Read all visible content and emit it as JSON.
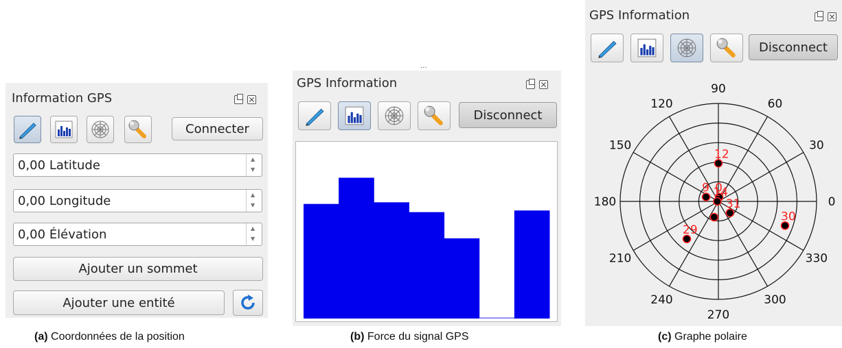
{
  "panel_a": {
    "title": "Information GPS",
    "connect_label": "Connecter",
    "fields": [
      {
        "value": "0,00",
        "name": "Latitude"
      },
      {
        "value": "0,00",
        "name": "Longitude"
      },
      {
        "value": "0,00",
        "name": "Élévation"
      }
    ],
    "add_vertex_label": "Ajouter un sommet",
    "add_feature_label": "Ajouter une entité"
  },
  "panel_b": {
    "title": "GPS Information",
    "disconnect_label": "Disconnect",
    "dots": "..."
  },
  "panel_c": {
    "title": "GPS Information",
    "disconnect_label": "Disconnect"
  },
  "captions": [
    {
      "tag": "(a)",
      "text": "Coordonnées de la position"
    },
    {
      "tag": "(b)",
      "text": "Force du signal GPS"
    },
    {
      "tag": "(c)",
      "text": "Graphe polaire"
    }
  ],
  "colors": {
    "bar": "#0000ee",
    "satellite_label": "#ff2020",
    "panel_bg": "#efefef"
  },
  "chart_data": [
    {
      "type": "bar",
      "description_of_axes": "none printed",
      "values": [
        0.7,
        0.86,
        0.71,
        0.65,
        0.49,
        0.0,
        0.66
      ]
    },
    {
      "type": "scatter",
      "coordinate_system": "polar",
      "angle_labels": [
        "90",
        "60",
        "30",
        "0",
        "330",
        "300",
        "270",
        "240",
        "210",
        "180",
        "150",
        "120"
      ],
      "satellites": [
        {
          "id": "12",
          "azimuth": 90,
          "elevation": 55
        },
        {
          "id": "9",
          "azimuth": 160,
          "elevation": 78
        },
        {
          "id": "0",
          "azimuth": 80,
          "elevation": 86
        },
        {
          "id": "14",
          "azimuth": 180,
          "elevation": 89
        },
        {
          "id": "31",
          "azimuth": 315,
          "elevation": 75
        },
        {
          "id": "29",
          "azimuth": 230,
          "elevation": 45
        },
        {
          "id": "30",
          "azimuth": 340,
          "elevation": 25
        },
        {
          "id": "",
          "azimuth": 255,
          "elevation": 75
        }
      ]
    }
  ]
}
